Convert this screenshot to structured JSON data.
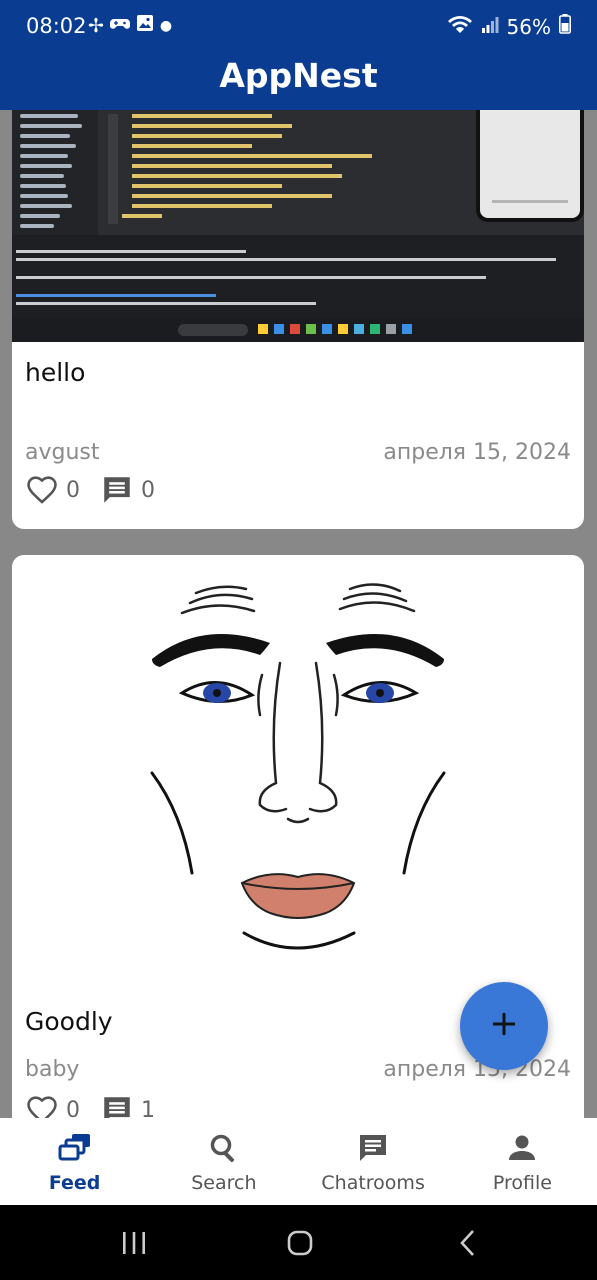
{
  "status_bar": {
    "time": "08:02",
    "battery_percent": "56%",
    "left_icons": [
      "fan-icon",
      "game-controller-icon",
      "image-icon",
      "notification-dot-icon"
    ],
    "right_icons": [
      "wifi-icon",
      "signal-icon",
      "battery-icon"
    ]
  },
  "app": {
    "title": "AppNest",
    "primary_color": "#0a3d91",
    "fab_color": "#3a78d8"
  },
  "posts": [
    {
      "title": "hello",
      "author": "avgust",
      "date": "апреля 15, 2024",
      "likes": "0",
      "comments": "0",
      "image": "screenshot-of-code-editor"
    },
    {
      "title": "Goodly",
      "author": "baby",
      "date": "апреля 15, 2024",
      "likes": "0",
      "comments": "1",
      "image": "face-drawing"
    }
  ],
  "fab": {
    "icon": "plus-icon"
  },
  "bottom_nav": {
    "items": [
      {
        "label": "Feed",
        "icon": "feed-icon",
        "active": true
      },
      {
        "label": "Search",
        "icon": "search-icon",
        "active": false
      },
      {
        "label": "Chatrooms",
        "icon": "chat-icon",
        "active": false
      },
      {
        "label": "Profile",
        "icon": "person-icon",
        "active": false
      }
    ]
  },
  "system_nav": {
    "icons": [
      "recent-apps-icon",
      "home-icon",
      "back-icon"
    ]
  }
}
